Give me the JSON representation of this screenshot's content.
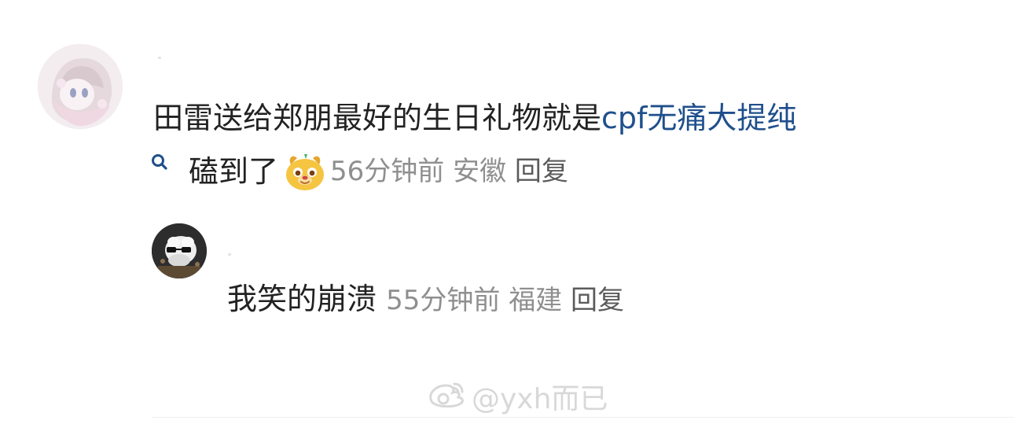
{
  "comment": {
    "text_main": "田雷送给郑朋最好的生日礼物就是",
    "link_text": "cpf无痛大提纯",
    "text_second": "磕到了",
    "emoji": "dog-smile-emoji",
    "meta_time": "56分钟前",
    "meta_location": "安徽",
    "reply_label": "回复"
  },
  "reply": {
    "text": "我笑的崩溃",
    "meta_time": "55分钟前",
    "meta_location": "福建",
    "reply_label": "回复"
  },
  "watermark": {
    "text": "@yxh而已",
    "icon": "weibo-logo-icon"
  },
  "icons": {
    "search": "search-icon"
  }
}
